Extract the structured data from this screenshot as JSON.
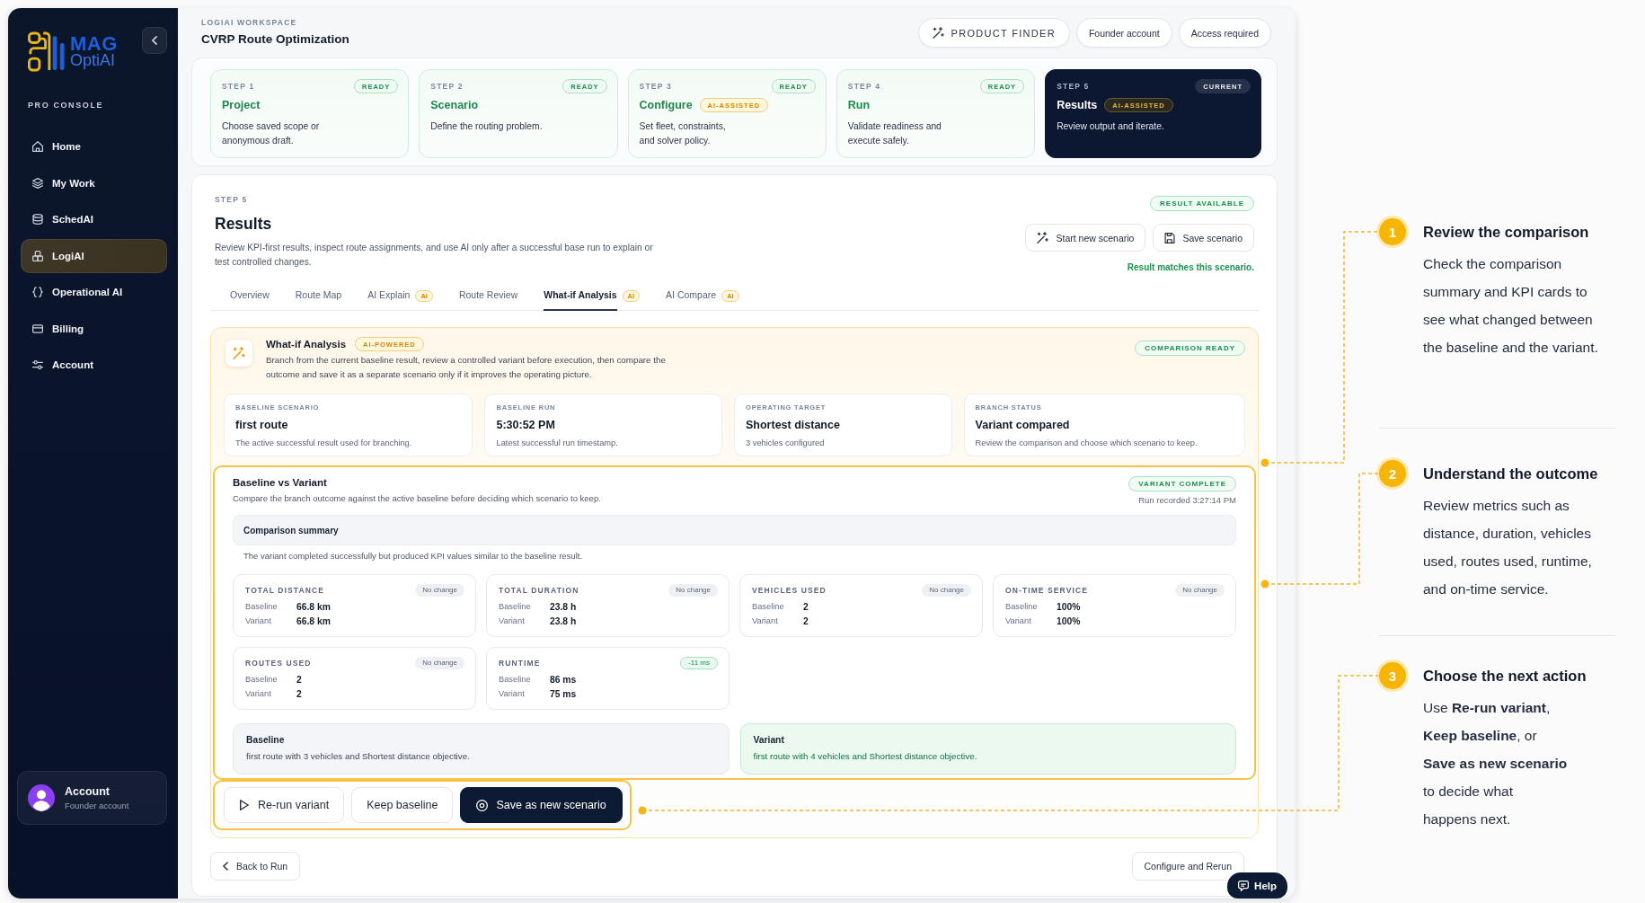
{
  "sidebar": {
    "logo": {
      "line_1": "MAG",
      "line_2": "OptiAI"
    },
    "section_label": "PRO CONSOLE",
    "items": [
      {
        "label": "Home",
        "selected": false
      },
      {
        "label": "My Work",
        "selected": false
      },
      {
        "label": "SchedAI",
        "selected": false
      },
      {
        "label": "LogiAI",
        "selected": true
      },
      {
        "label": "Operational AI",
        "selected": false
      },
      {
        "label": "Billing",
        "selected": false
      },
      {
        "label": "Account",
        "selected": false
      }
    ],
    "account": {
      "name": "Account",
      "role": "Founder account"
    }
  },
  "header": {
    "eyebrow": "LOGIAI WORKSPACE",
    "title": "CVRP Route Optimization",
    "buttons": [
      {
        "label": "PRODUCT FINDER",
        "kind": "finder"
      },
      {
        "label": "Founder account",
        "kind": "plain"
      },
      {
        "label": "Access required",
        "kind": "plain"
      }
    ]
  },
  "steps": [
    {
      "step": "STEP 1",
      "title": "Project",
      "status": "READY",
      "description": "Choose saved scope or\nanonymous draft.",
      "selected": false
    },
    {
      "step": "STEP 2",
      "title": "Scenario",
      "status": "READY",
      "description": "Define the routing problem.",
      "selected": false
    },
    {
      "step": "STEP 3",
      "title": "Configure",
      "ai_badge": "AI-ASSISTED",
      "status": "READY",
      "description": "Set fleet, constraints,\nand solver policy.",
      "selected": false
    },
    {
      "step": "STEP 4",
      "title": "Run",
      "status": "READY",
      "description": "Validate readiness and\nexecute safely.",
      "selected": false
    },
    {
      "step": "STEP 5",
      "title": "Results",
      "ai_badge": "AI-ASSISTED",
      "status": "CURRENT",
      "description": "Review output and iterate.",
      "selected": true
    }
  ],
  "results": {
    "eyebrow": "STEP 5",
    "title": "Results",
    "description": "Review KPI-first results, inspect route assignments, and use AI only after a successful base run to explain or\ntest controlled changes.",
    "status_badge": "RESULT AVAILABLE",
    "actions": [
      {
        "label": "Start new scenario",
        "kind": "start"
      },
      {
        "label": "Save scenario",
        "kind": "save"
      }
    ],
    "match_note": "Result matches this scenario.",
    "tabs": [
      {
        "label": "Overview",
        "selected": false
      },
      {
        "label": "Route Map",
        "selected": false
      },
      {
        "label": "AI Explain",
        "ai_badge": "AI",
        "selected": false
      },
      {
        "label": "Route Review",
        "selected": false
      },
      {
        "label": "What-if Analysis",
        "ai_badge": "AI",
        "selected": true
      },
      {
        "label": "AI Compare",
        "ai_badge": "AI",
        "selected": false
      }
    ]
  },
  "what_if": {
    "title": "What-if Analysis",
    "badge": "AI-POWERED",
    "description": "Branch from the current baseline result, review a controlled variant before execution, then compare the\noutcome and save it as a separate scenario only if it improves the operating picture.",
    "status_badge": "COMPARISON READY",
    "info_cards": [
      {
        "label": "BASELINE SCENARIO",
        "value": "first route",
        "note": "The active successful result used for branching."
      },
      {
        "label": "BASELINE RUN",
        "value": "5:30:52 PM",
        "note": "Latest successful run timestamp."
      },
      {
        "label": "OPERATING TARGET",
        "value": "Shortest distance",
        "note": "3 vehicles configured"
      },
      {
        "label": "BRANCH STATUS",
        "value": "Variant compared",
        "note": "Review the comparison and choose which scenario to keep."
      }
    ]
  },
  "comparison": {
    "highlighted": true,
    "title": "Baseline vs Variant",
    "description": "Compare the branch outcome against the active baseline before deciding which scenario to keep.",
    "status_badge": "VARIANT COMPLETE",
    "run_recorded": "Run recorded 3:27:14 PM",
    "summary_title": "Comparison summary",
    "summary_text": "The variant completed successfully but produced KPI values similar to the baseline result.",
    "kpis": [
      {
        "label": "TOTAL DISTANCE",
        "change": "No change",
        "improved": false,
        "rows": [
          {
            "label": "Baseline",
            "value": "66.8 km"
          },
          {
            "label": "Variant",
            "value": "66.8 km"
          }
        ]
      },
      {
        "label": "TOTAL DURATION",
        "change": "No change",
        "improved": false,
        "rows": [
          {
            "label": "Baseline",
            "value": "23.8 h"
          },
          {
            "label": "Variant",
            "value": "23.8 h"
          }
        ]
      },
      {
        "label": "VEHICLES USED",
        "change": "No change",
        "improved": false,
        "rows": [
          {
            "label": "Baseline",
            "value": "2"
          },
          {
            "label": "Variant",
            "value": "2"
          }
        ]
      },
      {
        "label": "ON-TIME SERVICE",
        "change": "No change",
        "improved": false,
        "rows": [
          {
            "label": "Baseline",
            "value": "100%"
          },
          {
            "label": "Variant",
            "value": "100%"
          }
        ]
      },
      {
        "label": "ROUTES USED",
        "change": "No change",
        "improved": false,
        "rows": [
          {
            "label": "Baseline",
            "value": "2"
          },
          {
            "label": "Variant",
            "value": "2"
          }
        ]
      },
      {
        "label": "RUNTIME",
        "change": "-11 ms",
        "improved": true,
        "rows": [
          {
            "label": "Baseline",
            "value": "86 ms"
          },
          {
            "label": "Variant",
            "value": "75 ms"
          }
        ]
      }
    ],
    "narratives": [
      {
        "kind": "baseline",
        "title": "Baseline",
        "text": "first route with 3 vehicles and Shortest distance objective."
      },
      {
        "kind": "variant",
        "title": "Variant",
        "text": "first route with 4 vehicles and Shortest distance objective."
      }
    ]
  },
  "variant_actions": {
    "highlighted": true,
    "buttons": [
      {
        "label": "Re-run variant",
        "kind": "rerun"
      },
      {
        "label": "Keep baseline",
        "kind": "keep"
      },
      {
        "label": "Save as new scenario",
        "kind": "save"
      }
    ]
  },
  "footer": {
    "back": "Back to Run",
    "forward": "Configure and Rerun",
    "help": "Help"
  },
  "guide": [
    {
      "number": "1",
      "title": "Review the comparison",
      "body": "Check the comparison\nsummary and KPI cards to\nsee what changed between\nthe baseline and the variant."
    },
    {
      "number": "2",
      "title": "Understand the outcome",
      "body": "Review metrics such as\ndistance, duration, vehicles\nused, routes used, runtime,\nand on-time service."
    },
    {
      "number": "3",
      "title": "Choose the next action",
      "body": "Use **Re-run variant**,\n**Keep baseline**, or\n**Save as new scenario**\nto decide what\nhappens next."
    }
  ]
}
